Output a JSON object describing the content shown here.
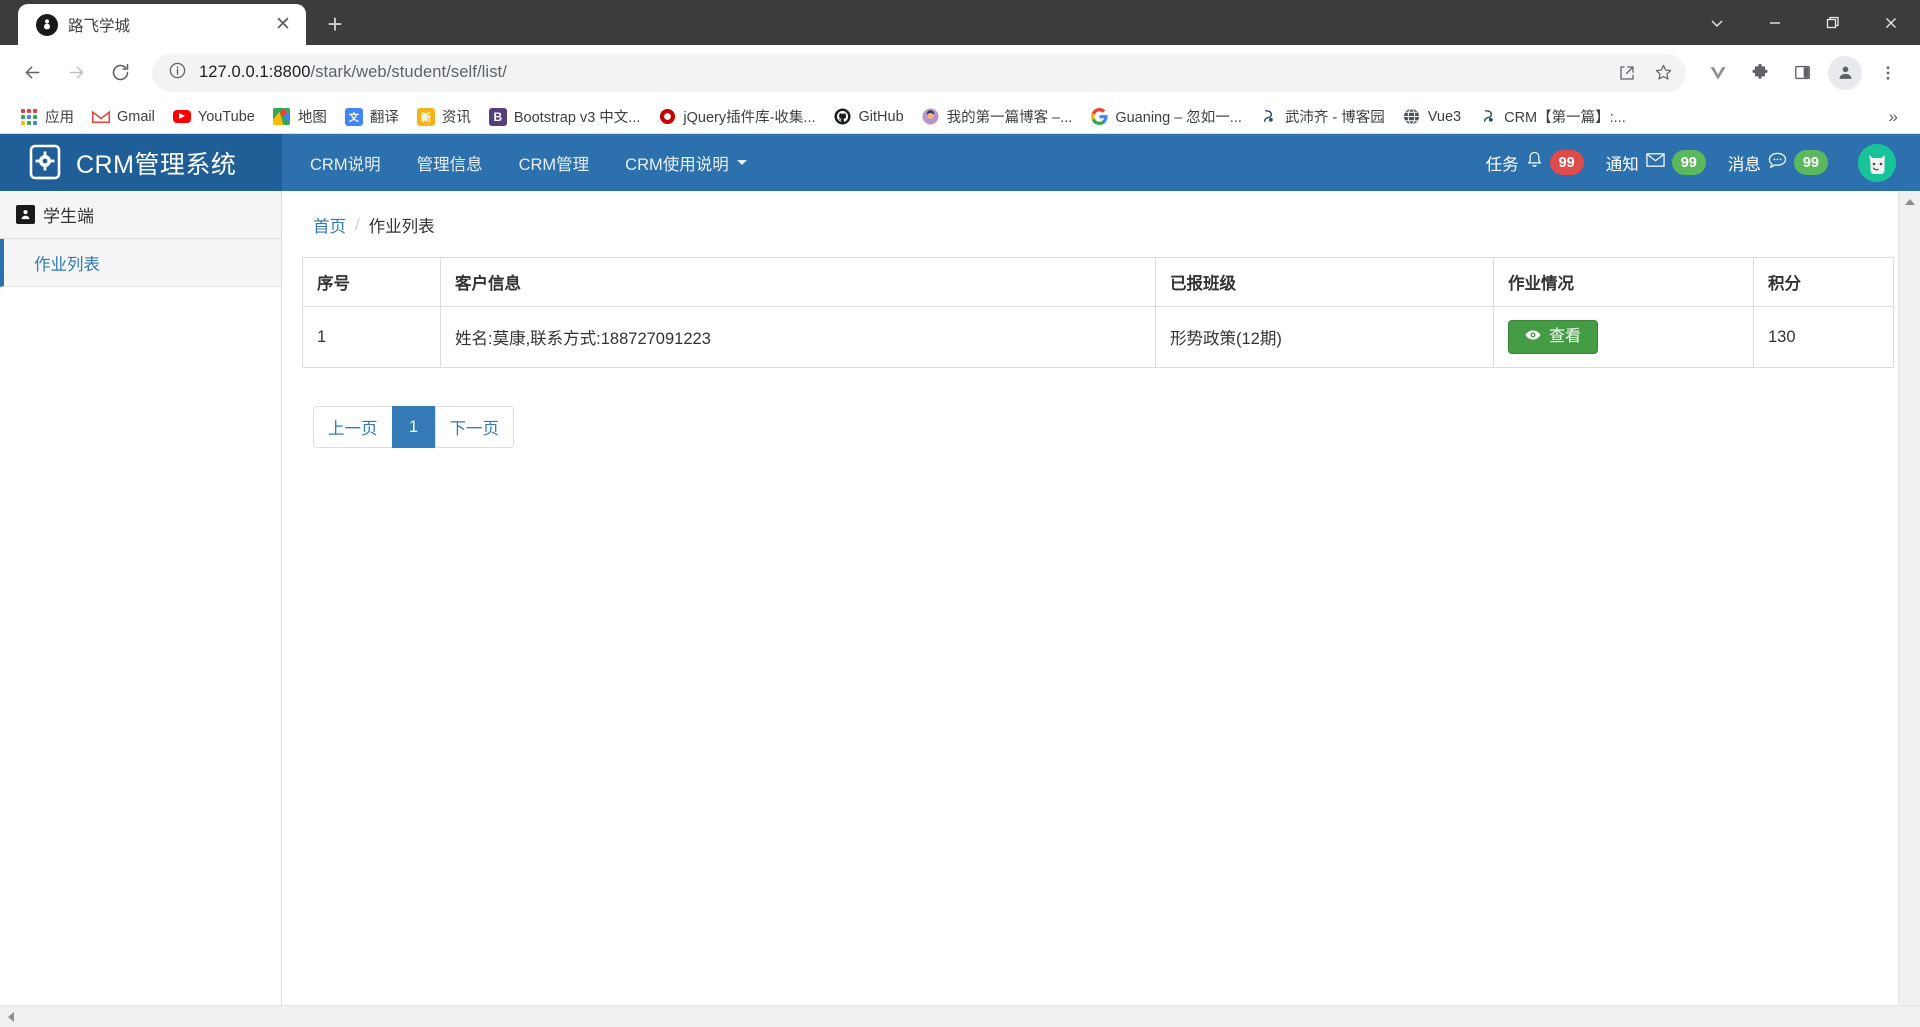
{
  "browser": {
    "tab": {
      "title": "路飞学城",
      "favicon": "person-logo-icon",
      "close_label": "✕"
    },
    "newtab_label": "+",
    "window_controls": {
      "tabsearch": "tab-search",
      "minimize": "minimize",
      "maximize": "maximize",
      "close": "close"
    },
    "nav": {
      "back": "back-arrow",
      "forward": "forward-arrow",
      "reload": "reload"
    },
    "omnibox": {
      "url_host": "127.0.0.1:8800",
      "url_path": "/stark/web/student/self/list/",
      "info_icon": "site-info-icon",
      "share_icon": "share-icon",
      "bookmark_icon": "star-icon"
    },
    "toolbar_right": {
      "vue_devtools": "vue-devtools-icon",
      "extensions": "puzzle-icon",
      "side_panel": "side-panel-icon",
      "profile": "profile-avatar-icon",
      "menu": "three-dot-menu-icon"
    },
    "bookmarks": [
      {
        "label": "应用",
        "icon": "apps-grid-icon"
      },
      {
        "label": "Gmail",
        "icon": "gmail-icon"
      },
      {
        "label": "YouTube",
        "icon": "youtube-icon"
      },
      {
        "label": "地图",
        "icon": "google-maps-icon"
      },
      {
        "label": "翻译",
        "icon": "google-translate-icon"
      },
      {
        "label": "资讯",
        "icon": "google-news-icon"
      },
      {
        "label": "Bootstrap v3 中文...",
        "icon": "bootstrap-icon"
      },
      {
        "label": "jQuery插件库-收集...",
        "icon": "jquery-icon"
      },
      {
        "label": "GitHub",
        "icon": "github-icon"
      },
      {
        "label": "我的第一篇博客 –...",
        "icon": "blog-avatar-icon"
      },
      {
        "label": "Guaning – 忽如一...",
        "icon": "google-icon"
      },
      {
        "label": "武沛齐 - 博客园",
        "icon": "cnblogs-icon"
      },
      {
        "label": "Vue3",
        "icon": "globe-icon"
      },
      {
        "label": "CRM【第一篇】:...",
        "icon": "cnblogs-icon"
      }
    ],
    "bookmarks_overflow": "»"
  },
  "app": {
    "brand": {
      "title": "CRM管理系统",
      "logo": "gear-tablet-icon"
    },
    "nav_links": [
      {
        "label": "CRM说明",
        "dropdown": false
      },
      {
        "label": "管理信息",
        "dropdown": false
      },
      {
        "label": "CRM管理",
        "dropdown": false
      },
      {
        "label": "CRM使用说明",
        "dropdown": true
      }
    ],
    "nav_stats": [
      {
        "label": "任务",
        "icon": "bell-icon",
        "count": "99",
        "color": "#e04b4b"
      },
      {
        "label": "通知",
        "icon": "envelope-icon",
        "count": "99",
        "color": "#5cb85c"
      },
      {
        "label": "消息",
        "icon": "comment-icon",
        "count": "99",
        "color": "#5cb85c"
      }
    ],
    "user_avatar": "cat-avatar-icon",
    "sidebar": {
      "header": {
        "label": "学生端",
        "icon": "student-user-icon"
      },
      "items": [
        {
          "label": "作业列表",
          "active": true
        }
      ]
    },
    "breadcrumb": {
      "home": "首页",
      "separator": "/",
      "current": "作业列表"
    },
    "table": {
      "columns": [
        "序号",
        "客户信息",
        "已报班级",
        "作业情况",
        "积分"
      ],
      "rows": [
        {
          "index": "1",
          "customer": "姓名:莫康,联系方式:188727091223",
          "class": "形势政策(12期)",
          "action_label": "查看",
          "action_icon": "eye-icon",
          "points": "130"
        }
      ]
    },
    "pagination": [
      {
        "label": "上一页",
        "active": false
      },
      {
        "label": "1",
        "active": true
      },
      {
        "label": "下一页",
        "active": false
      }
    ]
  },
  "colors": {
    "navbar": "#2c71ad",
    "brand_bg": "#1f5e96",
    "link": "#337ab7",
    "success": "#449d44",
    "danger": "#e04b4b"
  }
}
